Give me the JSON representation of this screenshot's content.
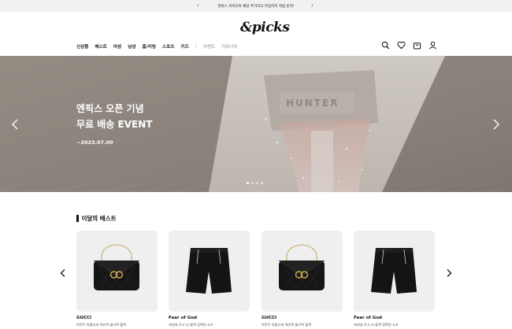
{
  "announcement": {
    "text": "엔픽스 카카오톡 채널 추가하고 마일리지 적립 받자!",
    "prev_icon": "chevron-left-icon",
    "next_icon": "chevron-right-icon"
  },
  "header": {
    "logo": "&picks",
    "nav": [
      "신상품",
      "베스트",
      "여성",
      "남성",
      "홈/리빙",
      "스포츠",
      "키즈"
    ],
    "nav_secondary": [
      "이벤트",
      "커뮤니티"
    ],
    "icons": [
      "search-icon",
      "heart-icon",
      "cart-icon",
      "user-icon"
    ]
  },
  "hero": {
    "title_line1": "엔픽스 오픈 기념",
    "title_line2": "무료 배송 EVENT",
    "date": "~2023.07.00",
    "image_text": "HUNTER",
    "slide_count": 4,
    "active_slide": 1
  },
  "best": {
    "title": "이달의 베스트",
    "products": [
      {
        "brand": "GUCCI",
        "desc": "마몬트 마틀라세 체인백 숄더백 블랙",
        "image": "black-handbag"
      },
      {
        "brand": "Fear of God",
        "desc": "에센셜 로고 더 블랙 컴팩션 쇼츠",
        "image": "black-shorts"
      },
      {
        "brand": "GUCCI",
        "desc": "마몬트 마틀라세 체인백 숄더백 블랙",
        "image": "black-handbag"
      },
      {
        "brand": "Fear of God",
        "desc": "에센셜 로고 더 블랙 컴팩션 쇼츠",
        "image": "black-shorts"
      }
    ]
  },
  "colors": {
    "accent": "#111111",
    "hero_bg": "#8f8780",
    "card_bg": "#efefef",
    "topbar_bg": "#f1f1f1"
  }
}
